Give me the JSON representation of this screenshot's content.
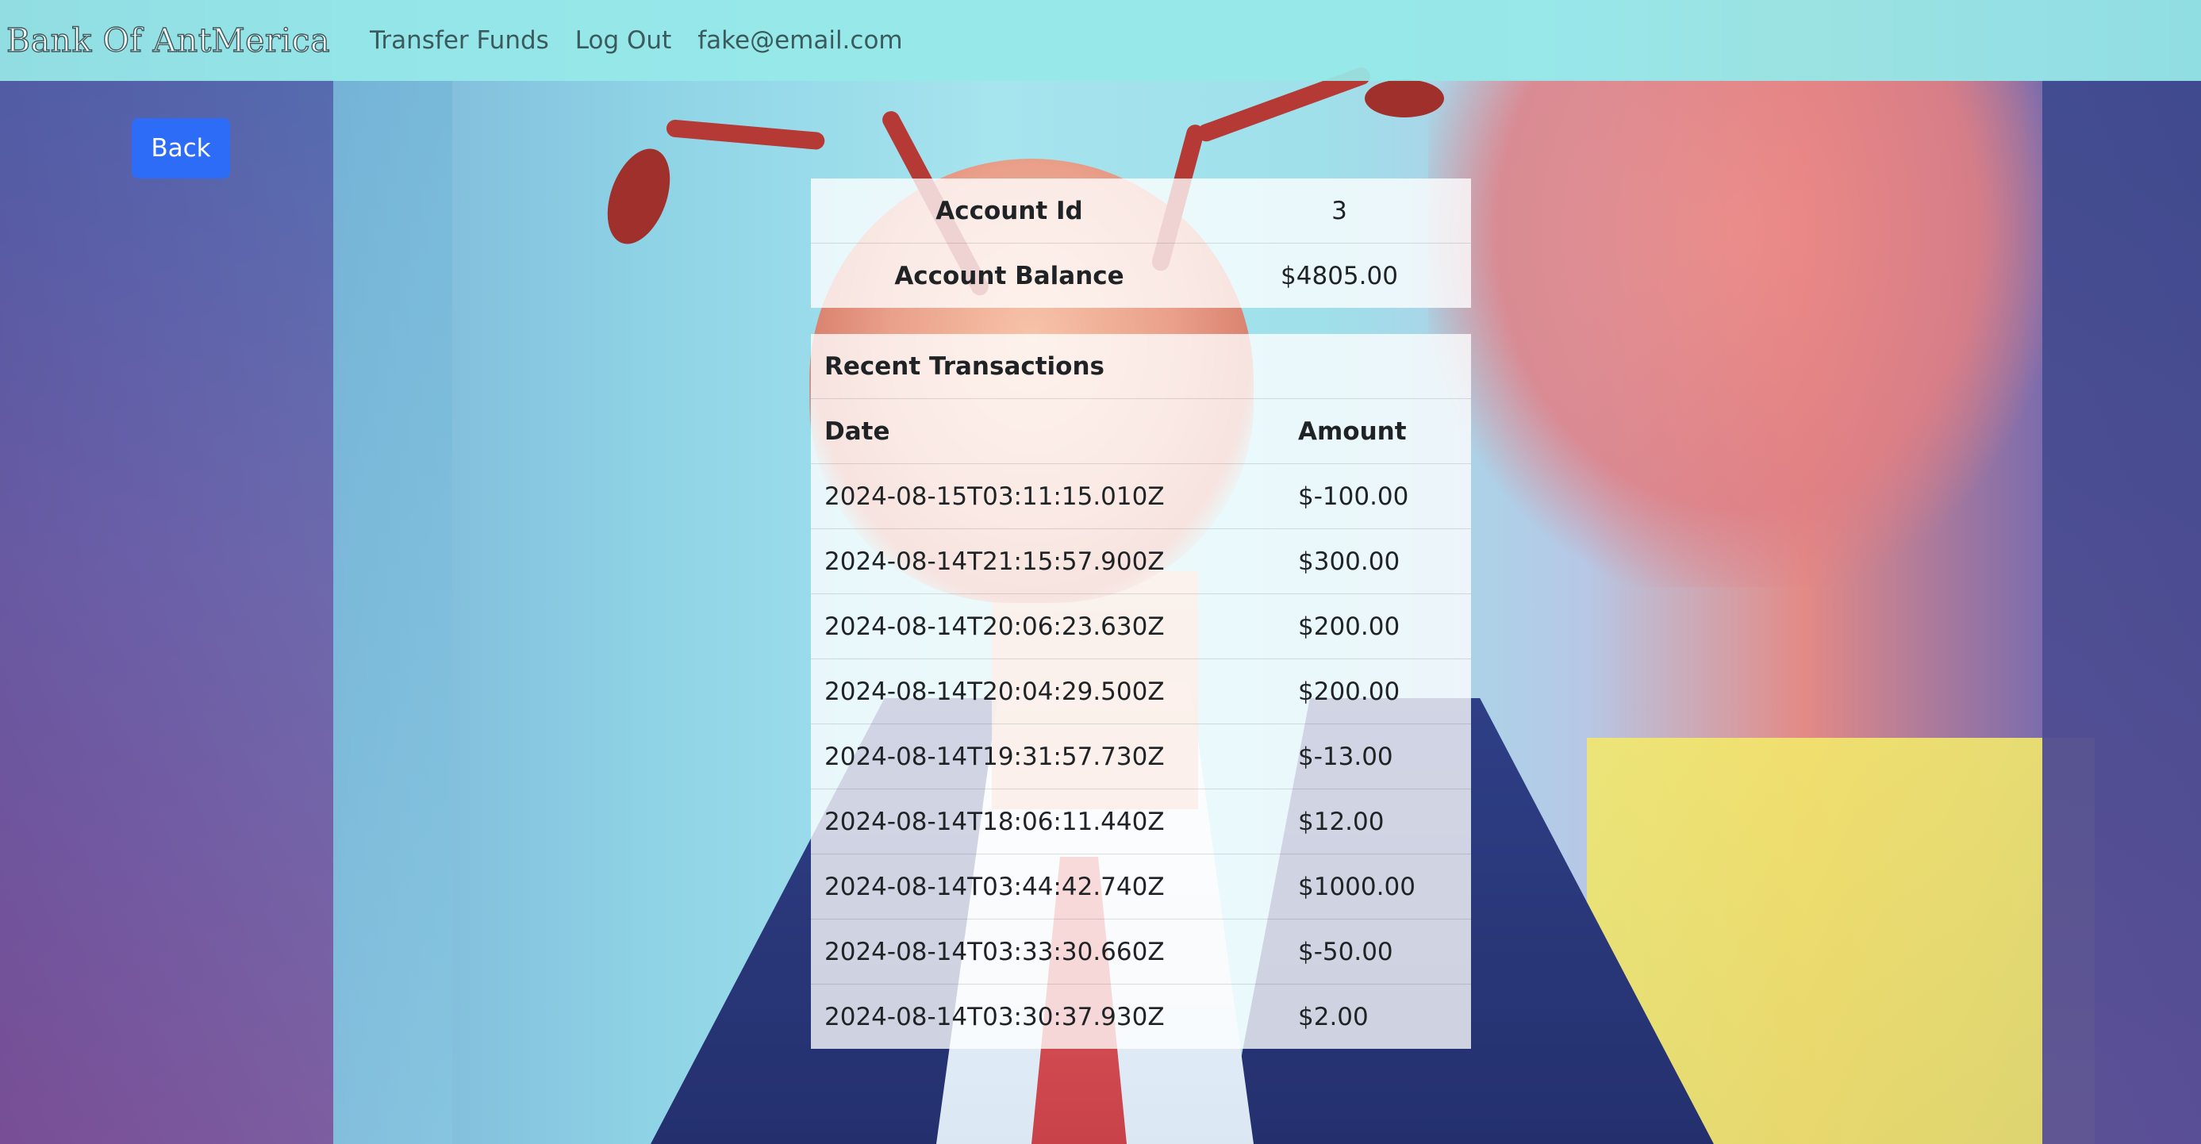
{
  "navbar": {
    "brand": "Bank Of AntMerica",
    "links": [
      "Transfer Funds",
      "Log Out",
      "fake@email.com"
    ]
  },
  "back_button": "Back",
  "account": {
    "rows": [
      {
        "label": "Account Id",
        "value": "3"
      },
      {
        "label": "Account Balance",
        "value": "$4805.00"
      }
    ]
  },
  "transactions": {
    "title": "Recent Transactions",
    "headers": [
      "Date",
      "Amount"
    ],
    "rows": [
      {
        "date": "2024-08-15T03:11:15.010Z",
        "amount": "$-100.00"
      },
      {
        "date": "2024-08-14T21:15:57.900Z",
        "amount": "$300.00"
      },
      {
        "date": "2024-08-14T20:06:23.630Z",
        "amount": "$200.00"
      },
      {
        "date": "2024-08-14T20:04:29.500Z",
        "amount": "$200.00"
      },
      {
        "date": "2024-08-14T19:31:57.730Z",
        "amount": "$-13.00"
      },
      {
        "date": "2024-08-14T18:06:11.440Z",
        "amount": "$12.00"
      },
      {
        "date": "2024-08-14T03:44:42.740Z",
        "amount": "$1000.00"
      },
      {
        "date": "2024-08-14T03:33:30.660Z",
        "amount": "$-50.00"
      },
      {
        "date": "2024-08-14T03:30:37.930Z",
        "amount": "$2.00"
      }
    ]
  },
  "colors": {
    "navbar_bg": "#96e8e8",
    "button_primary": "#2d6cf6",
    "text_dark": "#1f2326"
  }
}
